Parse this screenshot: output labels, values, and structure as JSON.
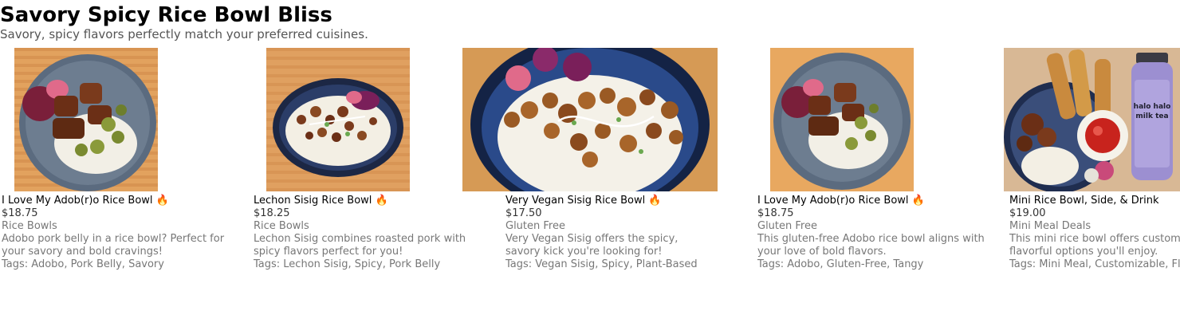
{
  "page": {
    "title": "Savory Spicy Rice Bowl Bliss",
    "subtitle": "Savory, spicy flavors perfectly match your preferred cuisines."
  },
  "cards": [
    {
      "name": "I Love My Adob(r)o Rice Bowl 🔥",
      "price": "$18.75",
      "category": "Rice Bowls",
      "description": "Adobo pork belly in a rice bowl? Perfect for your savory and bold cravings!",
      "tags": "Tags: Adobo, Pork Belly, Savory"
    },
    {
      "name": "Lechon Sisig Rice Bowl 🔥",
      "price": "$18.25",
      "category": "Rice Bowls",
      "description": "Lechon Sisig combines roasted pork with spicy flavors perfect for you!",
      "tags": "Tags: Lechon Sisig, Spicy, Pork Belly"
    },
    {
      "name": "Very Vegan Sisig Rice Bowl 🔥",
      "price": "$17.50",
      "category": "Gluten Free",
      "description": "Very Vegan Sisig offers the spicy, savory kick you're looking for!",
      "tags": "Tags: Vegan Sisig, Spicy, Plant-Based"
    },
    {
      "name": "I Love My Adob(r)o Rice Bowl 🔥",
      "price": "$18.75",
      "category": "Gluten Free",
      "description": "This gluten-free Adobo rice bowl aligns with your love of bold flavors.",
      "tags": "Tags: Adobo, Gluten-Free, Tangy"
    },
    {
      "name": "Mini Rice Bowl, Side, & Drink",
      "price": "$19.00",
      "category": "Mini Meal Deals",
      "description": "This mini rice bowl offers customizable, flavorful options you'll enjoy.",
      "tags": "Tags: Mini Meal, Customizable, Flavorful",
      "drink_label": "halo halo milk tea"
    }
  ],
  "colors": {
    "wood": "#e0a060",
    "plate_gray": "#5f6f82",
    "bowl_navy": "#1f2d4f",
    "rice": "#f4f1e8",
    "meat": "#7a3a1c"
  }
}
